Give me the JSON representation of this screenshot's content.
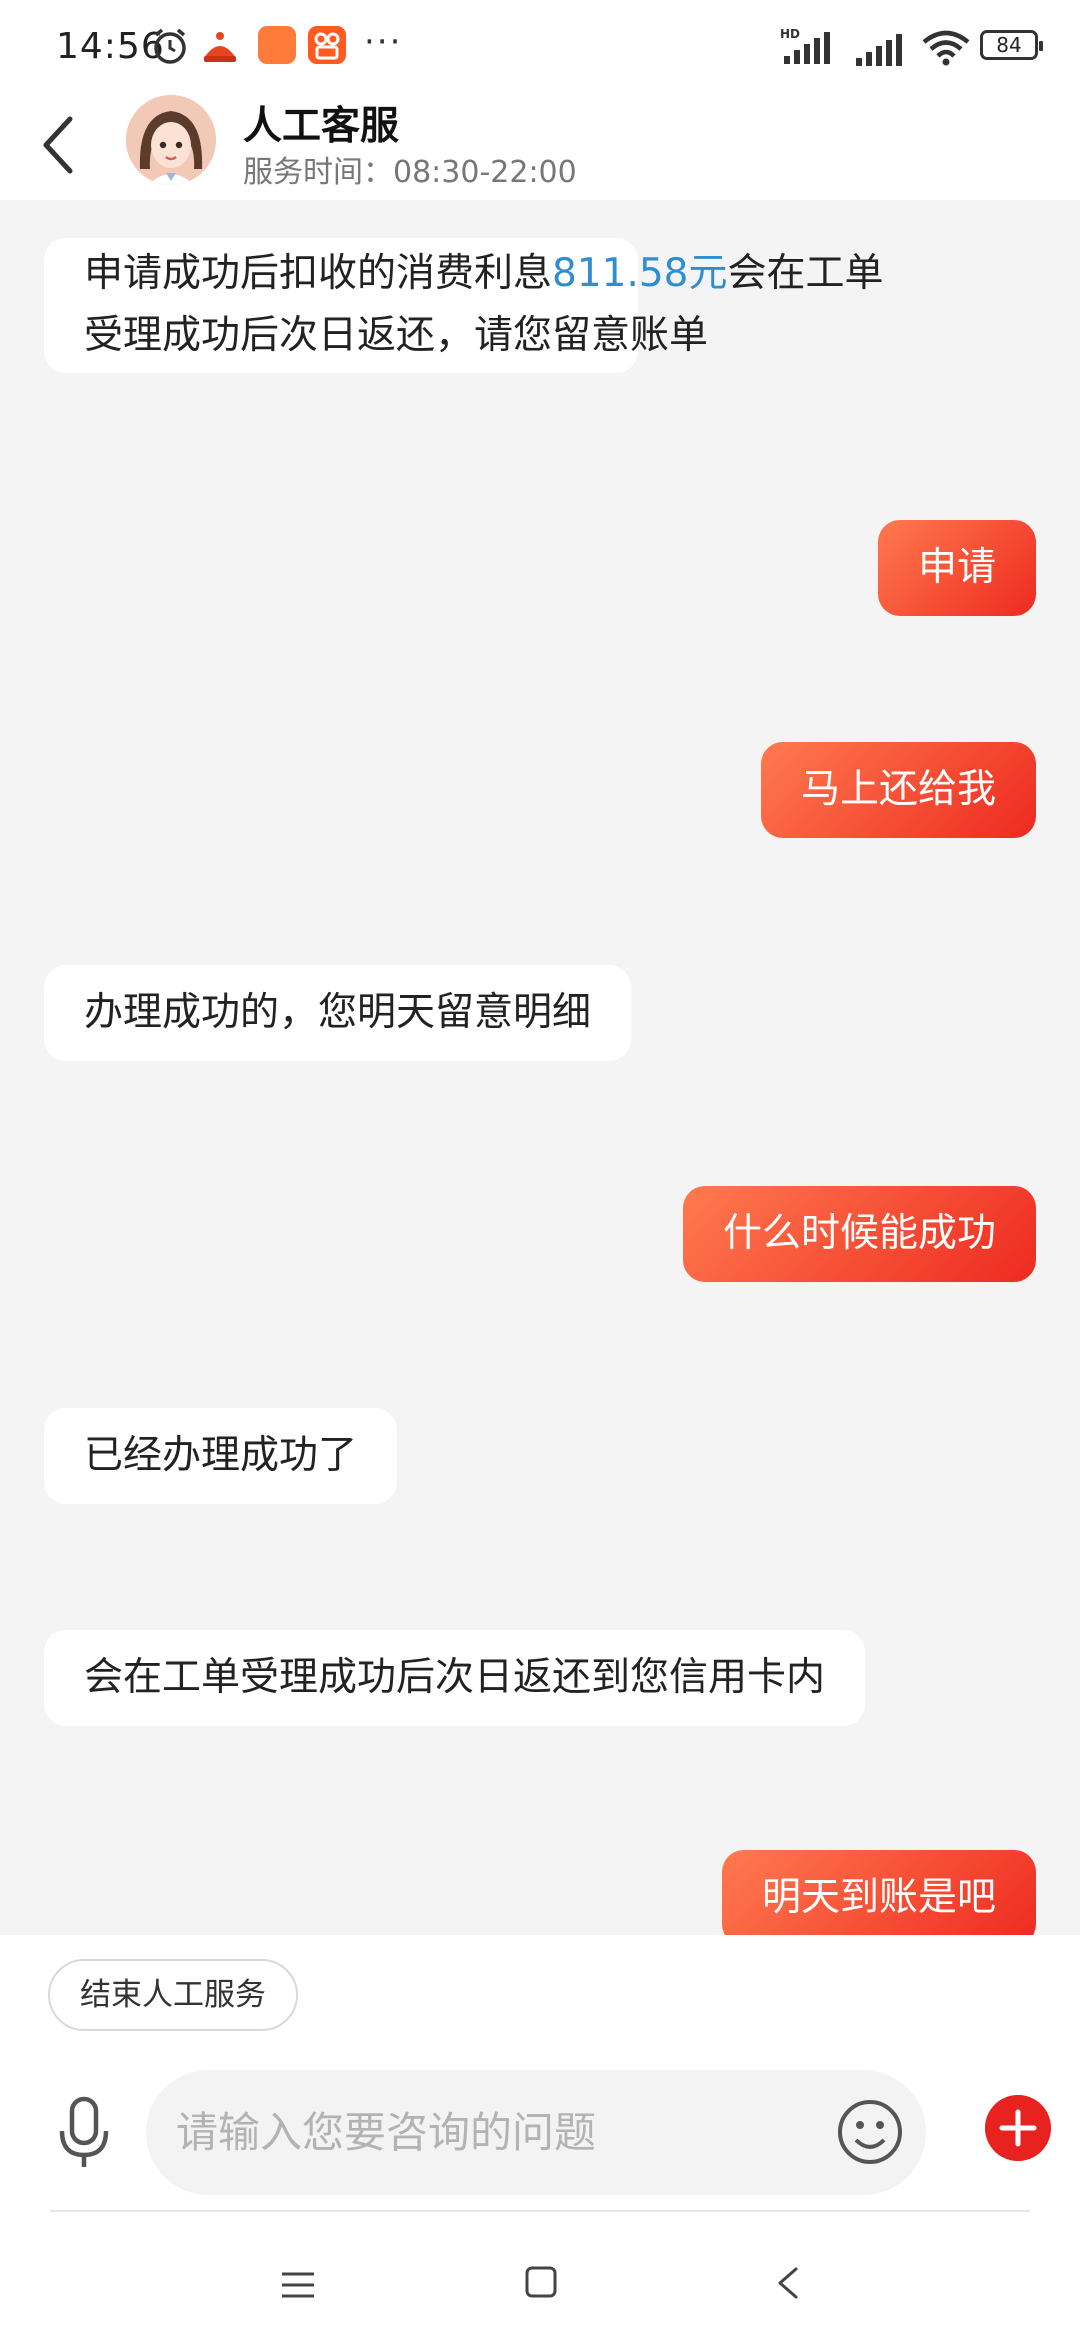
{
  "status_bar": {
    "time": "14:56",
    "battery": "84",
    "hd_label": "HD"
  },
  "header": {
    "title": "人工客服",
    "service_hours_prefix": "服务时间：",
    "service_hours": "08:30-22:00"
  },
  "messages": [
    {
      "side": "in",
      "text_before": "申请成功后扣收的消费利息",
      "highlight": "811.58元",
      "text_after_line1": "会在工单",
      "line2": "受理成功后次日返还，请您留意账单"
    },
    {
      "side": "out",
      "text": "申请"
    },
    {
      "side": "out",
      "text": "马上还给我"
    },
    {
      "side": "in",
      "text": "办理成功的，您明天留意明细"
    },
    {
      "side": "out",
      "text": "什么时候能成功"
    },
    {
      "side": "in",
      "text": "已经办理成功了"
    },
    {
      "side": "in",
      "text": "会在工单受理成功后次日返还到您信用卡内"
    },
    {
      "side": "out",
      "text": "明天到账是吧"
    }
  ],
  "bottom": {
    "end_service_label": "结束人工服务",
    "input_placeholder": "请输入您要咨询的问题"
  },
  "colors": {
    "accent_gradient_start": "#ff7a4f",
    "accent_gradient_end": "#ee2a20",
    "highlight": "#2f8ecf",
    "chat_background": "#f4f4f4"
  },
  "icons": {
    "back": "back-chevron-icon",
    "mic": "microphone-icon",
    "emoji": "emoji-icon",
    "plus": "plus-icon",
    "alarm": "alarm-icon",
    "wifi": "wifi-icon"
  }
}
